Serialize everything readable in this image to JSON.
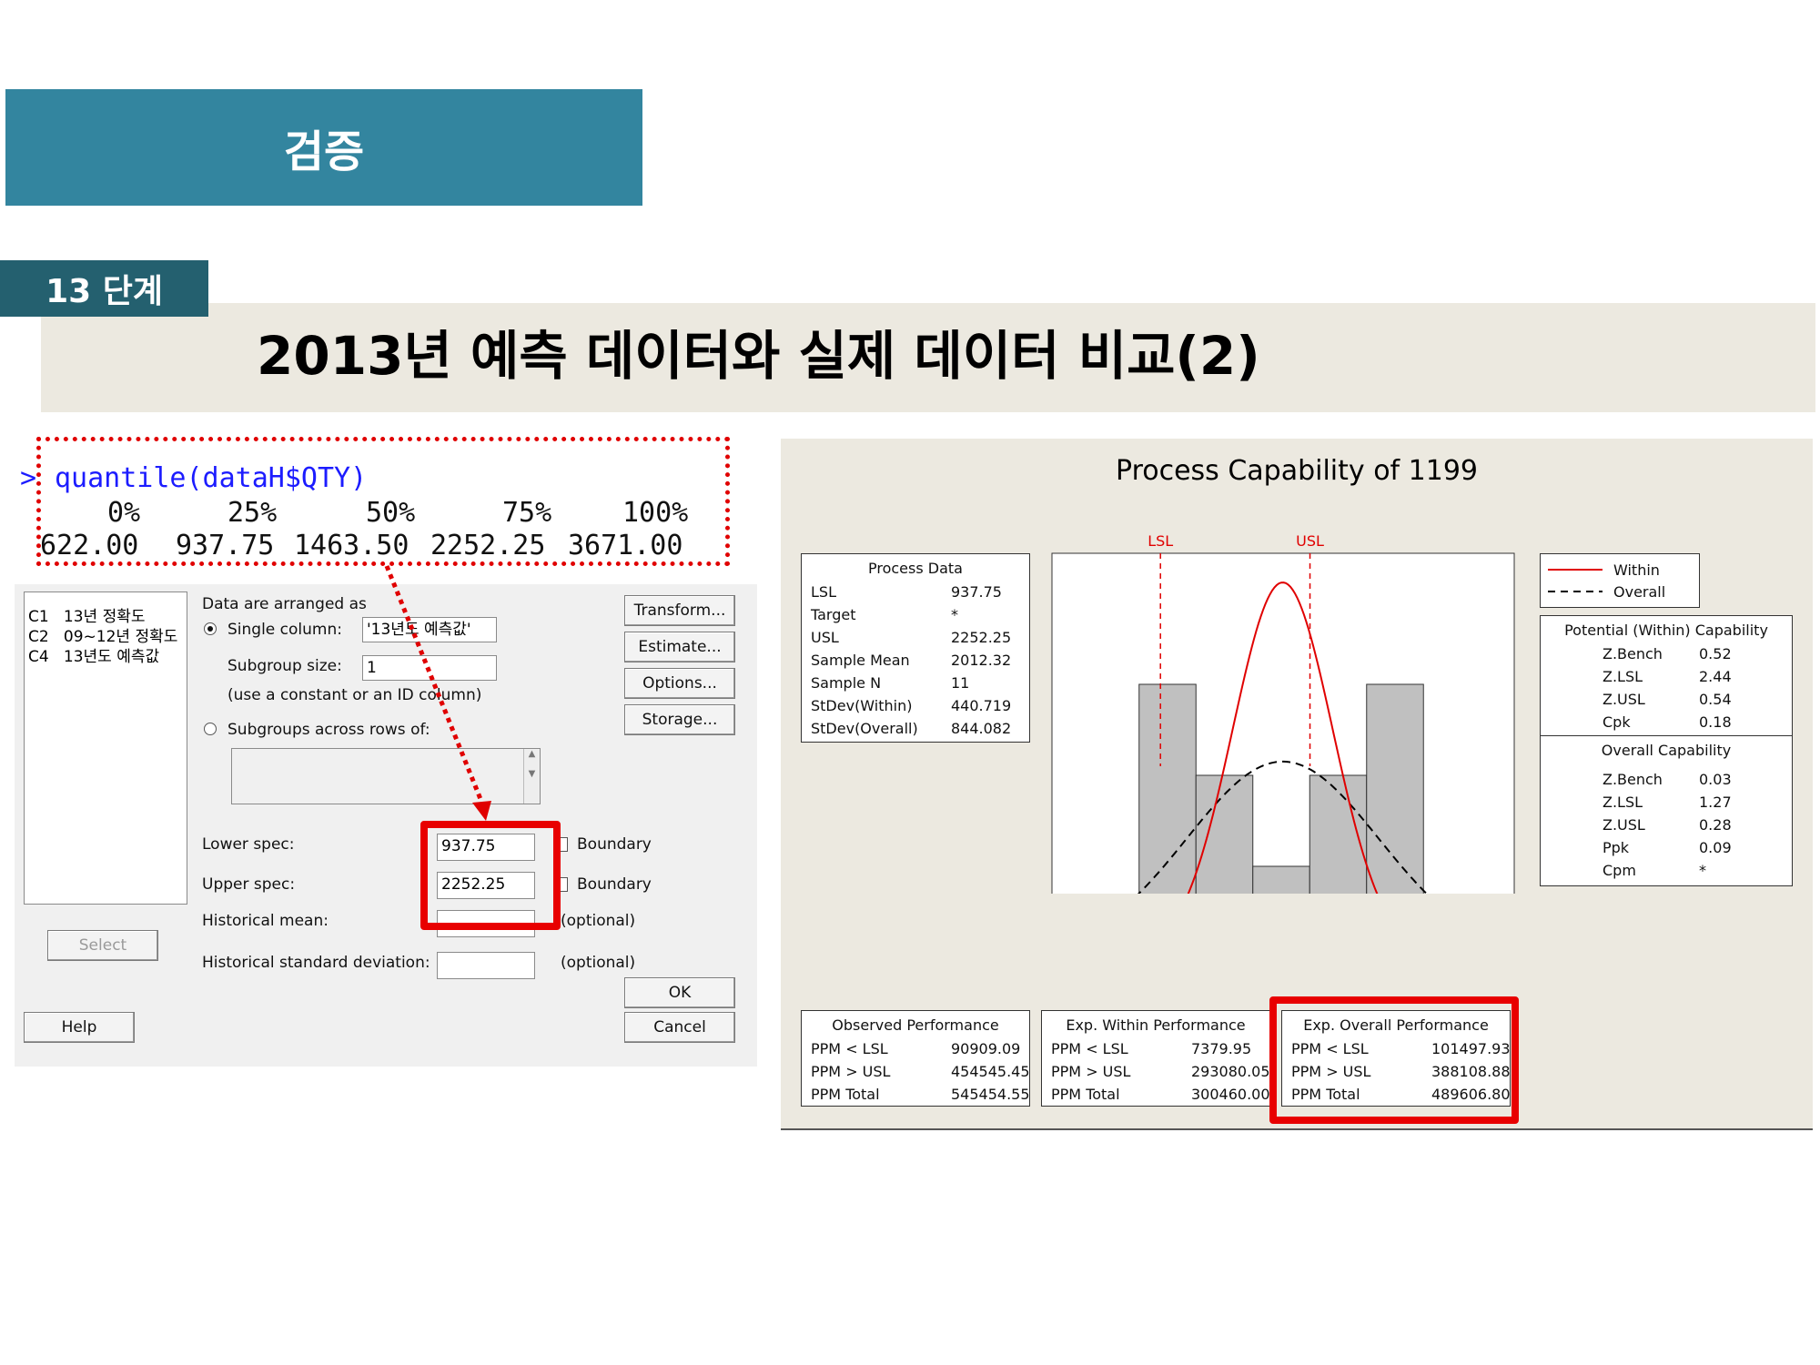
{
  "slide": {
    "header_title": "검증",
    "step_label": "13 단계",
    "subtitle": "2013년 예측 데이터와 실제 데이터 비교(2)"
  },
  "r_console": {
    "prompt": ">",
    "command": "quantile(dataH$QTY)",
    "quantiles": [
      {
        "label": "0%",
        "value": "622.00"
      },
      {
        "label": "25%",
        "value": "937.75"
      },
      {
        "label": "50%",
        "value": "1463.50"
      },
      {
        "label": "75%",
        "value": "2252.25"
      },
      {
        "label": "100%",
        "value": "3671.00"
      }
    ]
  },
  "dialog": {
    "columns": [
      {
        "id": "C1",
        "name": "13년 정확도"
      },
      {
        "id": "C2",
        "name": "09~12년 정확도"
      },
      {
        "id": "C4",
        "name": "13년도 예측값"
      }
    ],
    "data_arranged_label": "Data are arranged as",
    "single_column_label": "Single column:",
    "single_column_value": "'13년도 예측값'",
    "subgroup_size_label": "Subgroup size:",
    "subgroup_size_value": "1",
    "subgroup_hint": "(use a constant or an ID column)",
    "subgroups_across_label": "Subgroups across rows of:",
    "lower_spec_label": "Lower spec:",
    "lower_spec_value": "937.75",
    "upper_spec_label": "Upper spec:",
    "upper_spec_value": "2252.25",
    "boundary_label": "Boundary",
    "historical_mean_label": "Historical mean:",
    "historical_sd_label": "Historical standard deviation:",
    "optional_label": "(optional)",
    "buttons": {
      "transform": "Transform...",
      "estimate": "Estimate...",
      "options": "Options...",
      "storage": "Storage...",
      "select": "Select",
      "help": "Help",
      "ok": "OK",
      "cancel": "Cancel"
    }
  },
  "report": {
    "title": "Process Capability of 1199",
    "process_data": {
      "header": "Process Data",
      "rows": [
        {
          "k": "LSL",
          "v": "937.75"
        },
        {
          "k": "Target",
          "v": "*"
        },
        {
          "k": "USL",
          "v": "2252.25"
        },
        {
          "k": "Sample Mean",
          "v": "2012.32"
        },
        {
          "k": "Sample N",
          "v": "11"
        },
        {
          "k": "StDev(Within)",
          "v": "440.719"
        },
        {
          "k": "StDev(Overall)",
          "v": "844.082"
        }
      ]
    },
    "legend": {
      "within": "Within",
      "overall": "Overall"
    },
    "potential": {
      "header": "Potential (Within) Capability",
      "rows": [
        {
          "k": "Z.Bench",
          "v": "0.52"
        },
        {
          "k": "Z.LSL",
          "v": "2.44"
        },
        {
          "k": "Z.USL",
          "v": "0.54"
        },
        {
          "k": "Cpk",
          "v": "0.18"
        }
      ]
    },
    "overall": {
      "header": "Overall Capability",
      "rows": [
        {
          "k": "Z.Bench",
          "v": "0.03"
        },
        {
          "k": "Z.LSL",
          "v": "1.27"
        },
        {
          "k": "Z.USL",
          "v": "0.28"
        },
        {
          "k": "Ppk",
          "v": "0.09"
        },
        {
          "k": "Cpm",
          "v": "*"
        }
      ]
    },
    "observed": {
      "header": "Observed Performance",
      "rows": [
        {
          "k": "PPM < LSL",
          "v": "90909.09"
        },
        {
          "k": "PPM > USL",
          "v": "454545.45"
        },
        {
          "k": "PPM Total",
          "v": "545454.55"
        }
      ]
    },
    "exp_within": {
      "header": "Exp. Within Performance",
      "rows": [
        {
          "k": "PPM < LSL",
          "v": "7379.95"
        },
        {
          "k": "PPM > USL",
          "v": "293080.05"
        },
        {
          "k": "PPM Total",
          "v": "300460.00"
        }
      ]
    },
    "exp_overall": {
      "header": "Exp. Overall Performance",
      "rows": [
        {
          "k": "PPM < LSL",
          "v": "101497.93"
        },
        {
          "k": "PPM > USL",
          "v": "388108.88"
        },
        {
          "k": "PPM Total",
          "v": "489606.80"
        }
      ]
    },
    "chart": {
      "lsl_label": "LSL",
      "usl_label": "USL",
      "lsl": 937.75,
      "usl": 2252.25,
      "mean": 2012.32,
      "sd_within": 440.719,
      "sd_overall": 844.082,
      "x_ticks": [
        "0",
        "1000",
        "2000",
        "3000",
        "4000"
      ],
      "xlim": [
        0,
        4000
      ],
      "bins": [
        {
          "from": 750,
          "to": 1250,
          "count": 3
        },
        {
          "from": 1250,
          "to": 1750,
          "count": 2
        },
        {
          "from": 1750,
          "to": 2250,
          "count": 1
        },
        {
          "from": 2250,
          "to": 2750,
          "count": 2
        },
        {
          "from": 2750,
          "to": 3250,
          "count": 3
        }
      ],
      "colors": {
        "within": "#e00000",
        "overall": "#000000",
        "bar": "#c0c0c0",
        "spec": "#e00000"
      }
    }
  }
}
